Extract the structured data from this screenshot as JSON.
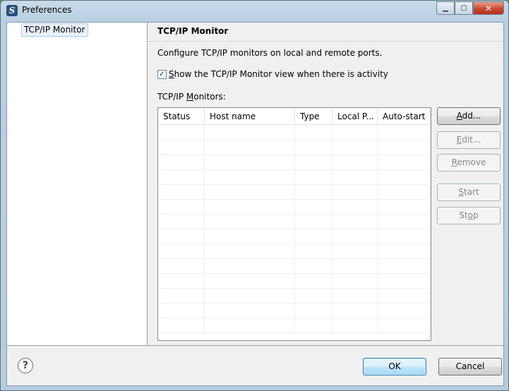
{
  "window": {
    "title": "Preferences",
    "icon": "eclipse-app-icon",
    "caption_buttons": {
      "minimize": "▁",
      "maximize": "▢",
      "close": "✕"
    }
  },
  "tree": {
    "items": [
      {
        "label": "TCP/IP Monitor",
        "selected": true
      }
    ]
  },
  "page": {
    "title": "TCP/IP Monitor",
    "description": "Configure TCP/IP monitors on local and remote ports.",
    "checkbox": {
      "checked": true,
      "mnemonic": "S",
      "label_rest": "how the TCP/IP Monitor view when there is activity"
    },
    "monitors_label_pre": "TCP/IP ",
    "monitors_label_mn": "M",
    "monitors_label_post": "onitors:",
    "table": {
      "columns": [
        "Status",
        "Host name",
        "Type",
        "Local P...",
        "Auto-start"
      ],
      "rows": []
    },
    "buttons": {
      "add": {
        "pre": "",
        "mn": "A",
        "post": "dd...",
        "enabled": true
      },
      "edit": {
        "pre": "",
        "mn": "E",
        "post": "dit...",
        "enabled": false
      },
      "remove": {
        "pre": "",
        "mn": "R",
        "post": "emove",
        "enabled": false
      },
      "start": {
        "pre": "",
        "mn": "S",
        "post": "tart",
        "enabled": false
      },
      "stop": {
        "pre": "St",
        "mn": "o",
        "post": "p",
        "enabled": false
      }
    }
  },
  "footer": {
    "help_icon": "?",
    "ok_label": "OK",
    "cancel_label": "Cancel"
  },
  "colors": {
    "default_button_border": "#3c7fb1",
    "tree_selection": "#eaf3fc",
    "disabled_text": "#8a8a8a"
  }
}
